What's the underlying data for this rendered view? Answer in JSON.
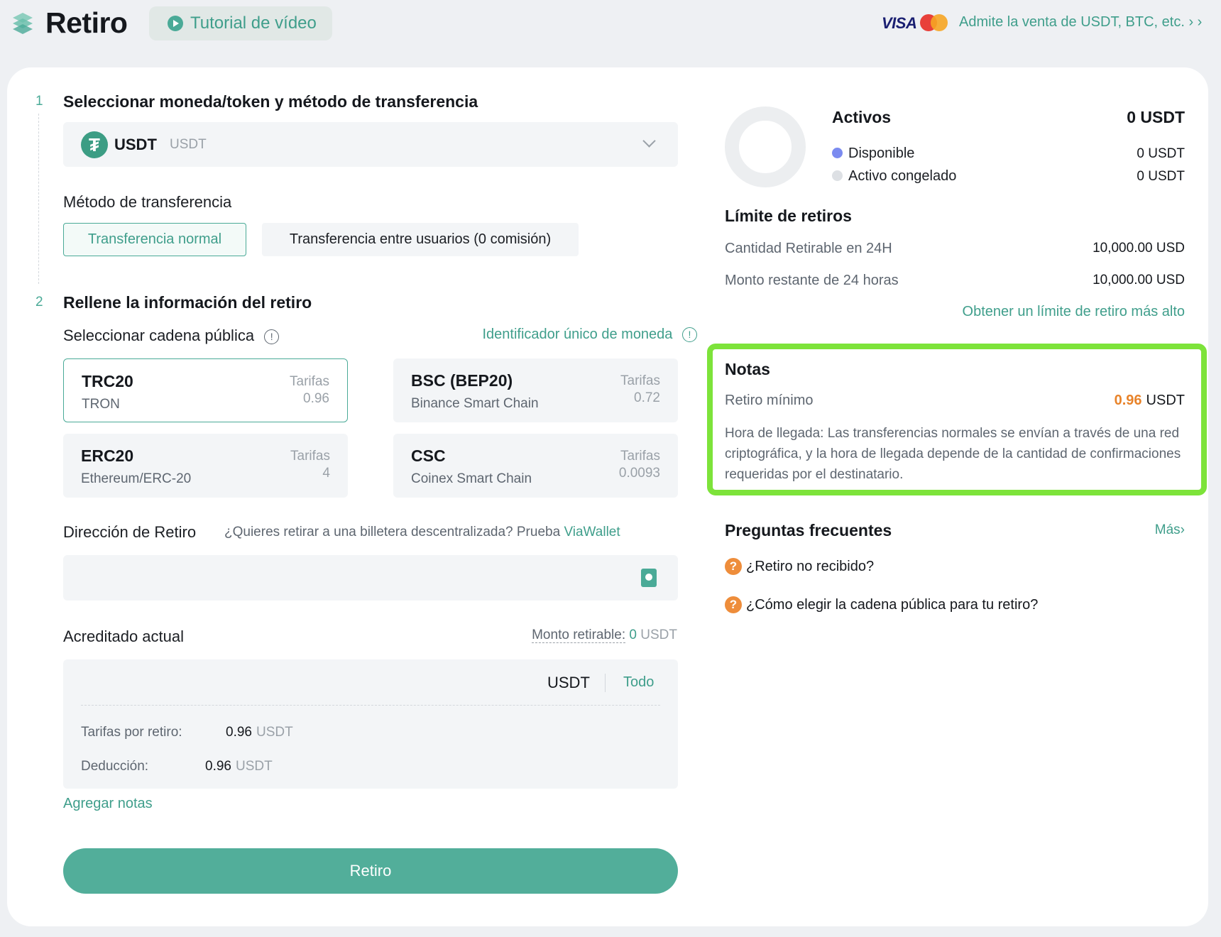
{
  "header": {
    "title": "Retiro",
    "tutorial_label": "Tutorial de vídeo",
    "visa_label": "VISA",
    "sell_link": "Admite la venta de USDT, BTC, etc. › ›"
  },
  "steps": {
    "step1_num": "1",
    "step1_title": "Seleccionar moneda/token y método de transferencia",
    "step2_num": "2",
    "step2_title": "Rellene la información del retiro"
  },
  "coin": {
    "symbol": "USDT",
    "sub": "USDT",
    "icon": "tether-icon"
  },
  "method": {
    "label": "Método de transferencia",
    "normal": "Transferencia normal",
    "internal": "Transferencia entre usuarios (0 comisión)"
  },
  "chain_section": {
    "label": "Seleccionar cadena pública",
    "id_link": "Identificador único de moneda",
    "chains": [
      {
        "name": "TRC20",
        "full": "TRON",
        "fee_label": "Tarifas",
        "fee": "0.96",
        "selected": true
      },
      {
        "name": "BSC (BEP20)",
        "full": "Binance Smart Chain",
        "fee_label": "Tarifas",
        "fee": "0.72"
      },
      {
        "name": "ERC20",
        "full": "Ethereum/ERC-20",
        "fee_label": "Tarifas",
        "fee": "4"
      },
      {
        "name": "CSC",
        "full": "Coinex Smart Chain",
        "fee_label": "Tarifas",
        "fee": "0.0093"
      }
    ]
  },
  "address": {
    "label": "Dirección de Retiro",
    "hint": "¿Quieres retirar a una billetera descentralizada? Prueba",
    "hint_link": "ViaWallet",
    "value": "",
    "placeholder": ""
  },
  "amount": {
    "label": "Acreditado actual",
    "available_label": "Monto retirable:",
    "available_value": "0",
    "available_unit": "USDT",
    "currency": "USDT",
    "all_label": "Todo",
    "fee_label": "Tarifas por retiro:",
    "fee_value": "0.96",
    "fee_unit": "USDT",
    "deduction_label": "Deducción:",
    "deduction_value": "0.96",
    "deduction_unit": "USDT"
  },
  "add_notes": "Agregar notas",
  "submit_label": "Retiro",
  "assets": {
    "title": "Activos",
    "total": "0 USDT",
    "available_label": "Disponible",
    "available_value": "0 USDT",
    "available_color": "#7b8bf0",
    "frozen_label": "Activo congelado",
    "frozen_value": "0 USDT",
    "frozen_color": "#dde0e4"
  },
  "limits": {
    "title": "Límite de retiros",
    "row1_label": "Cantidad Retirable en 24H",
    "row1_value": "10,000.00 USD",
    "row2_label": "Monto restante de 24 horas",
    "row2_value": "10,000.00 USD",
    "link": "Obtener un límite de retiro más alto"
  },
  "notes": {
    "title": "Notas",
    "min_label": "Retiro mínimo",
    "min_value": "0.96",
    "min_unit": "USDT",
    "arrival": "Hora de llegada: Las transferencias normales se envían a través de una red criptográfica, y la hora de llegada depende de la cantidad de confirmaciones requeridas por el destinatario."
  },
  "faq": {
    "title": "Preguntas frecuentes",
    "more": "Más›",
    "items": [
      "¿Retiro no recibido?",
      "¿Cómo elegir la cadena pública para tu retiro?"
    ]
  },
  "colors": {
    "accent": "#4aaa97",
    "button": "#52ae9a",
    "highlight": "#7de33a",
    "warning": "#e8832a"
  }
}
